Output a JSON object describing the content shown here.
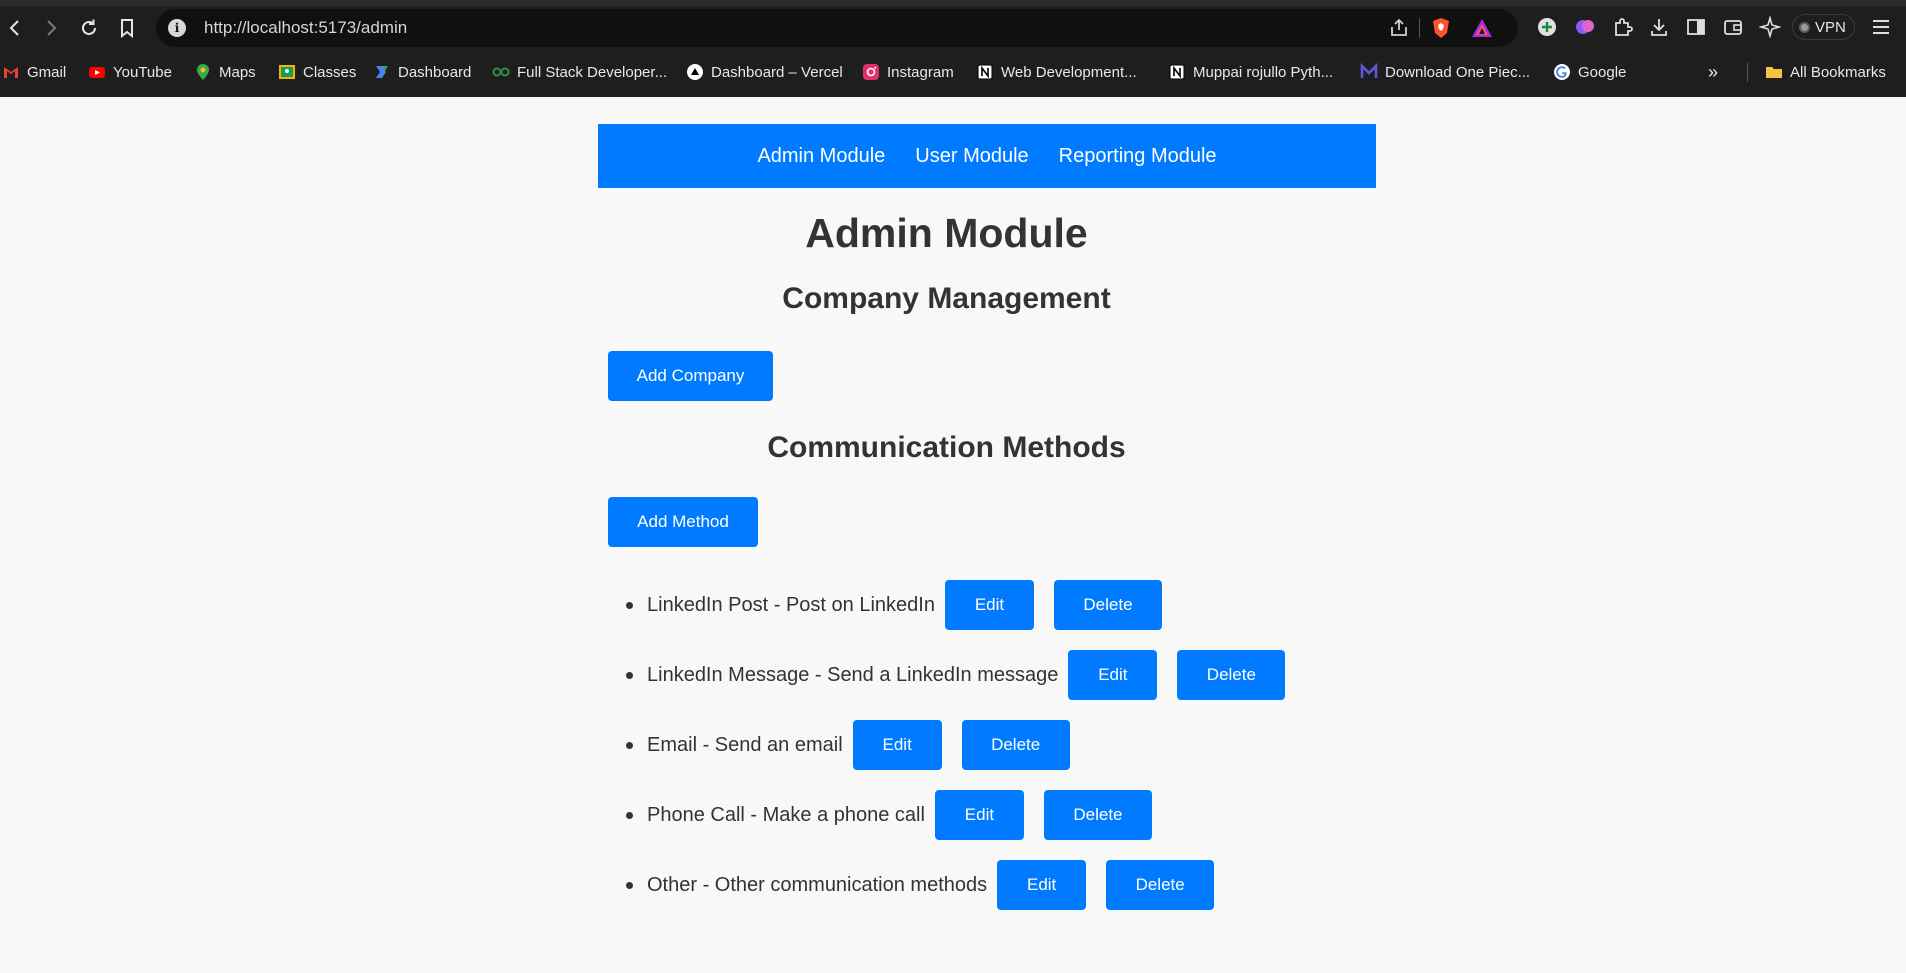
{
  "browser": {
    "url": "http://localhost:5173/admin",
    "vpn_label": "VPN",
    "bookmarks": [
      {
        "label": "Gmail",
        "icon": "gmail-icon",
        "color": "#ea4335"
      },
      {
        "label": "YouTube",
        "icon": "youtube-icon",
        "color": "#ff0000"
      },
      {
        "label": "Maps",
        "icon": "maps-icon",
        "color": "#34a853"
      },
      {
        "label": "Classes",
        "icon": "classroom-icon",
        "color": "#f4b400"
      },
      {
        "label": "Dashboard",
        "icon": "dashboard-icon",
        "color": "#4285f4"
      },
      {
        "label": "Full Stack Developer...",
        "icon": "geeksforgeeks-icon",
        "color": "#2f8d46"
      },
      {
        "label": "Dashboard – Vercel",
        "icon": "vercel-icon",
        "color": "#ffffff"
      },
      {
        "label": "Instagram",
        "icon": "instagram-icon",
        "color": "#e1306c"
      },
      {
        "label": "Web Development...",
        "icon": "notion-icon",
        "color": "#ffffff"
      },
      {
        "label": "Muppai rojullo Pyth...",
        "icon": "notion-icon",
        "color": "#ffffff"
      },
      {
        "label": "Download One Piec...",
        "icon": "manga-icon",
        "color": "#5b5bd6"
      },
      {
        "label": "Google",
        "icon": "google-icon",
        "color": "#4285f4"
      }
    ],
    "more_label": "»",
    "all_bookmarks_label": "All Bookmarks"
  },
  "navbar": {
    "items": [
      "Admin Module",
      "User Module",
      "Reporting Module"
    ]
  },
  "page": {
    "title": "Admin Module",
    "company_heading": "Company Management",
    "add_company_label": "Add Company",
    "methods_heading": "Communication Methods",
    "add_method_label": "Add Method",
    "edit_label": "Edit",
    "delete_label": "Delete",
    "methods": [
      {
        "text": "LinkedIn Post - Post on LinkedIn"
      },
      {
        "text": "LinkedIn Message - Send a LinkedIn message"
      },
      {
        "text": "Email - Send an email"
      },
      {
        "text": "Phone Call - Make a phone call"
      },
      {
        "text": "Other - Other communication methods"
      }
    ]
  },
  "colors": {
    "accent": "#007bff",
    "page_bg": "#f8f8f8",
    "text": "#333333"
  }
}
